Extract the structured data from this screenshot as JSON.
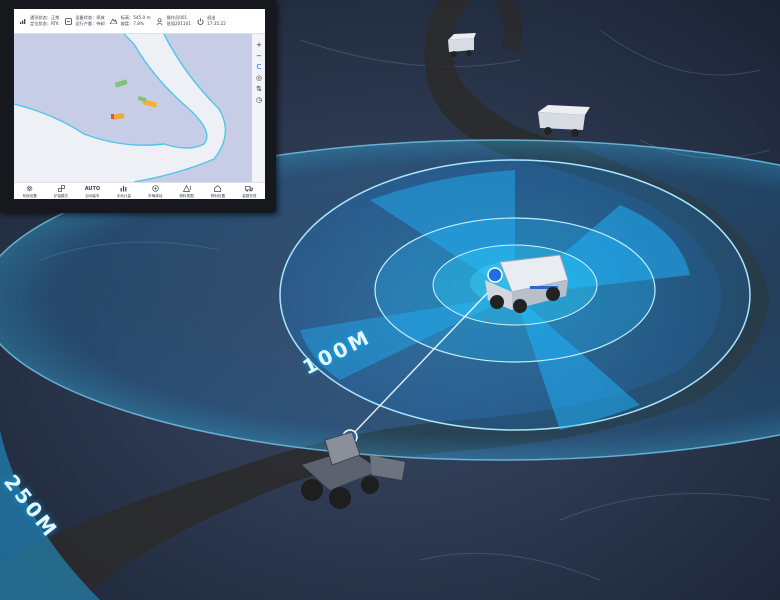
{
  "status": {
    "signal_label": "通讯状态：正常",
    "position_label": "定位状态：RTK",
    "device_state": "设备状态：停放",
    "work_state": "运行产量：待卸",
    "altitude": "标高：545.0 m",
    "slope": "坡度：7.8%",
    "user_line1": "操作员001",
    "user_line2": "班组201101",
    "exit_label": "退出",
    "time": "17:35:22"
  },
  "zoom_controls": {
    "zoom_in": "+",
    "zoom_out": "−",
    "refresh": "C",
    "locate": "◎",
    "layers": "⇅",
    "history": "◷"
  },
  "bottom_nav": [
    {
      "icon": "gear-icon",
      "label": "系统设置"
    },
    {
      "icon": "flow-icon",
      "label": "铲装模式"
    },
    {
      "icon": "auto-icon",
      "label": "自动装车",
      "glyph": "AUTO"
    },
    {
      "icon": "chart-icon",
      "label": "手动计量"
    },
    {
      "icon": "target-icon",
      "label": "车辆调动"
    },
    {
      "icon": "warning-icon",
      "label": "物料表图"
    },
    {
      "icon": "home-icon",
      "label": "物料处置"
    },
    {
      "icon": "truck-icon",
      "label": "装载完成"
    }
  ],
  "ranges": {
    "inner": "100M",
    "outer": "250M"
  },
  "colors": {
    "accent": "#1fb6ff",
    "map_land": "#c7cde6",
    "map_boundary": "#53c6e8",
    "loader": "#f0b429",
    "truck": "#7cc576"
  }
}
